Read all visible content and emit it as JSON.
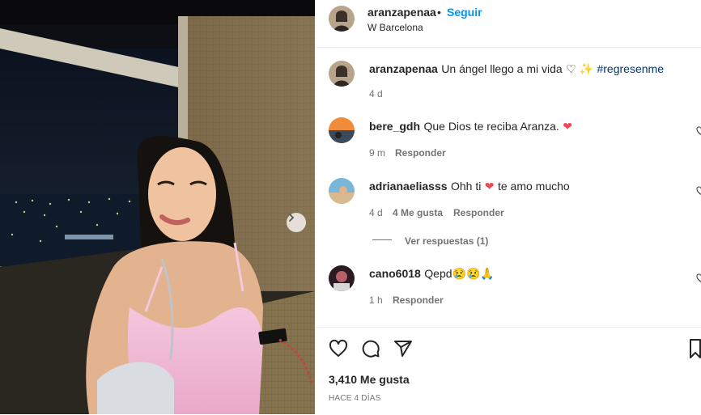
{
  "post": {
    "username": "aranzapenaa",
    "separator": "•",
    "follow_label": "Seguir",
    "location": "W Barcelona",
    "caption_text": "Un ángel llego a mi vida",
    "caption_emoji": "♡ ✨",
    "caption_hashtag": "#regresenme",
    "caption_time": "4 d",
    "likes": "3,410 Me gusta",
    "date": "HACE 4 DÍAS"
  },
  "comments": [
    {
      "user": "bere_gdh",
      "text": "Que Dios te reciba Aranza.",
      "emoji": "❤",
      "time": "9 m",
      "reply_label": "Responder"
    },
    {
      "user": "adrianaeliasss",
      "text_before": "Ohh ti",
      "emoji": "❤",
      "text_after": "te amo mucho",
      "time": "4 d",
      "likes": "4 Me gusta",
      "reply_label": "Responder"
    },
    {
      "user": "cano6018",
      "text": "Qepd",
      "emoji": "😢😢🙏",
      "time": "1 h",
      "reply_label": "Responder"
    }
  ],
  "view_replies_label": "Ver respuestas (1)",
  "icons": {
    "like": "heart-icon",
    "comment": "comment-icon",
    "share": "paper-plane-icon",
    "save": "bookmark-icon",
    "next": "chevron-right-icon"
  },
  "colors": {
    "link": "#00376b",
    "follow": "#0095f6",
    "heart": "#ed4956",
    "meta": "#737373"
  }
}
